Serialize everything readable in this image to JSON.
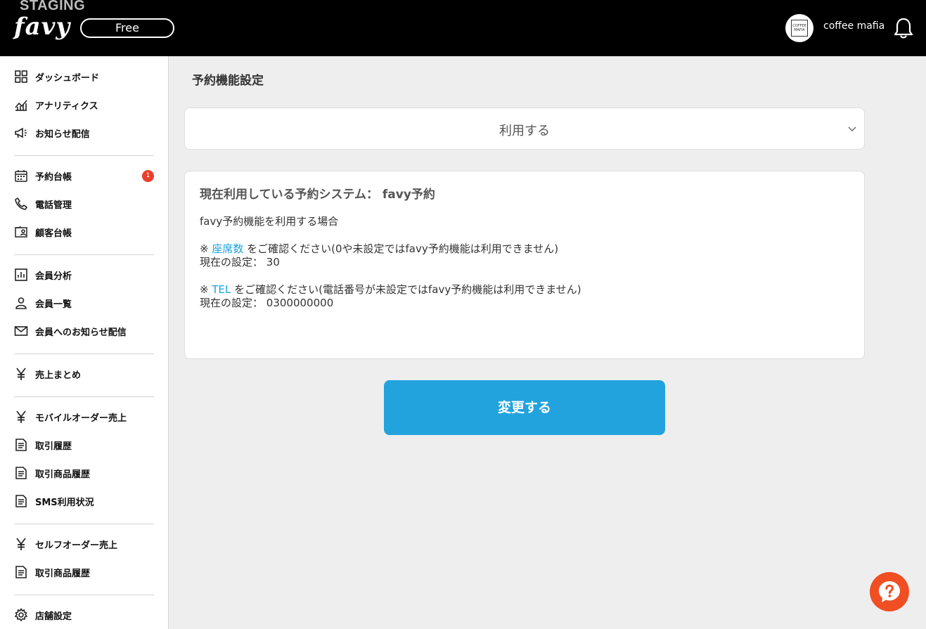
{
  "header": {
    "environment": "STAGING",
    "logo_text": "favy",
    "plan": "Free",
    "avatar_text": "COFFEE MAFIA",
    "shop_name": "coffee mafia"
  },
  "sidebar": {
    "groups": [
      [
        {
          "label": "ダッシュボード",
          "icon": "dashboard-icon"
        },
        {
          "label": "アナリティクス",
          "icon": "analytics-icon"
        },
        {
          "label": "お知らせ配信",
          "icon": "megaphone-icon"
        }
      ],
      [
        {
          "label": "予約台帳",
          "icon": "calendar-icon",
          "badge": "1"
        },
        {
          "label": "電話管理",
          "icon": "phone-icon"
        },
        {
          "label": "顧客台帳",
          "icon": "contact-card-icon"
        }
      ],
      [
        {
          "label": "会員分析",
          "icon": "bar-chart-icon"
        },
        {
          "label": "会員一覧",
          "icon": "person-icon"
        },
        {
          "label": "会員へのお知らせ配信",
          "icon": "mail-icon"
        }
      ],
      [
        {
          "label": "売上まとめ",
          "icon": "yen-icon"
        }
      ],
      [
        {
          "label": "モバイルオーダー売上",
          "icon": "yen-icon"
        },
        {
          "label": "取引履歴",
          "icon": "document-icon"
        },
        {
          "label": "取引商品履歴",
          "icon": "document-icon"
        },
        {
          "label": "SMS利用状況",
          "icon": "document-icon"
        }
      ],
      [
        {
          "label": "セルフオーダー売上",
          "icon": "yen-icon"
        },
        {
          "label": "取引商品履歴",
          "icon": "document-icon"
        }
      ],
      [
        {
          "label": "店舗設定",
          "icon": "gear-icon"
        }
      ]
    ]
  },
  "main": {
    "title": "予約機能設定",
    "select_value": "利用する",
    "info": {
      "title": "現在利用している予約システム： favy予約",
      "intro": "favy予約機能を利用する場合",
      "seats_prefix": "※ ",
      "seats_link": "座席数",
      "seats_suffix": " をご確認ください(0や未設定ではfavy予約機能は利用できません)",
      "seats_current_label": "現在の設定：",
      "seats_current_value": "30",
      "tel_prefix": "※ ",
      "tel_link": "TEL",
      "tel_suffix": " をご確認ください(電話番号が未設定ではfavy予約機能は利用できません)",
      "tel_current_label": "現在の設定：",
      "tel_current_value": "0300000000"
    },
    "submit_label": "変更する"
  },
  "colors": {
    "accent": "#22a3de",
    "link": "#1aa3de",
    "badge": "#e8402b",
    "help": "#f04e23"
  }
}
